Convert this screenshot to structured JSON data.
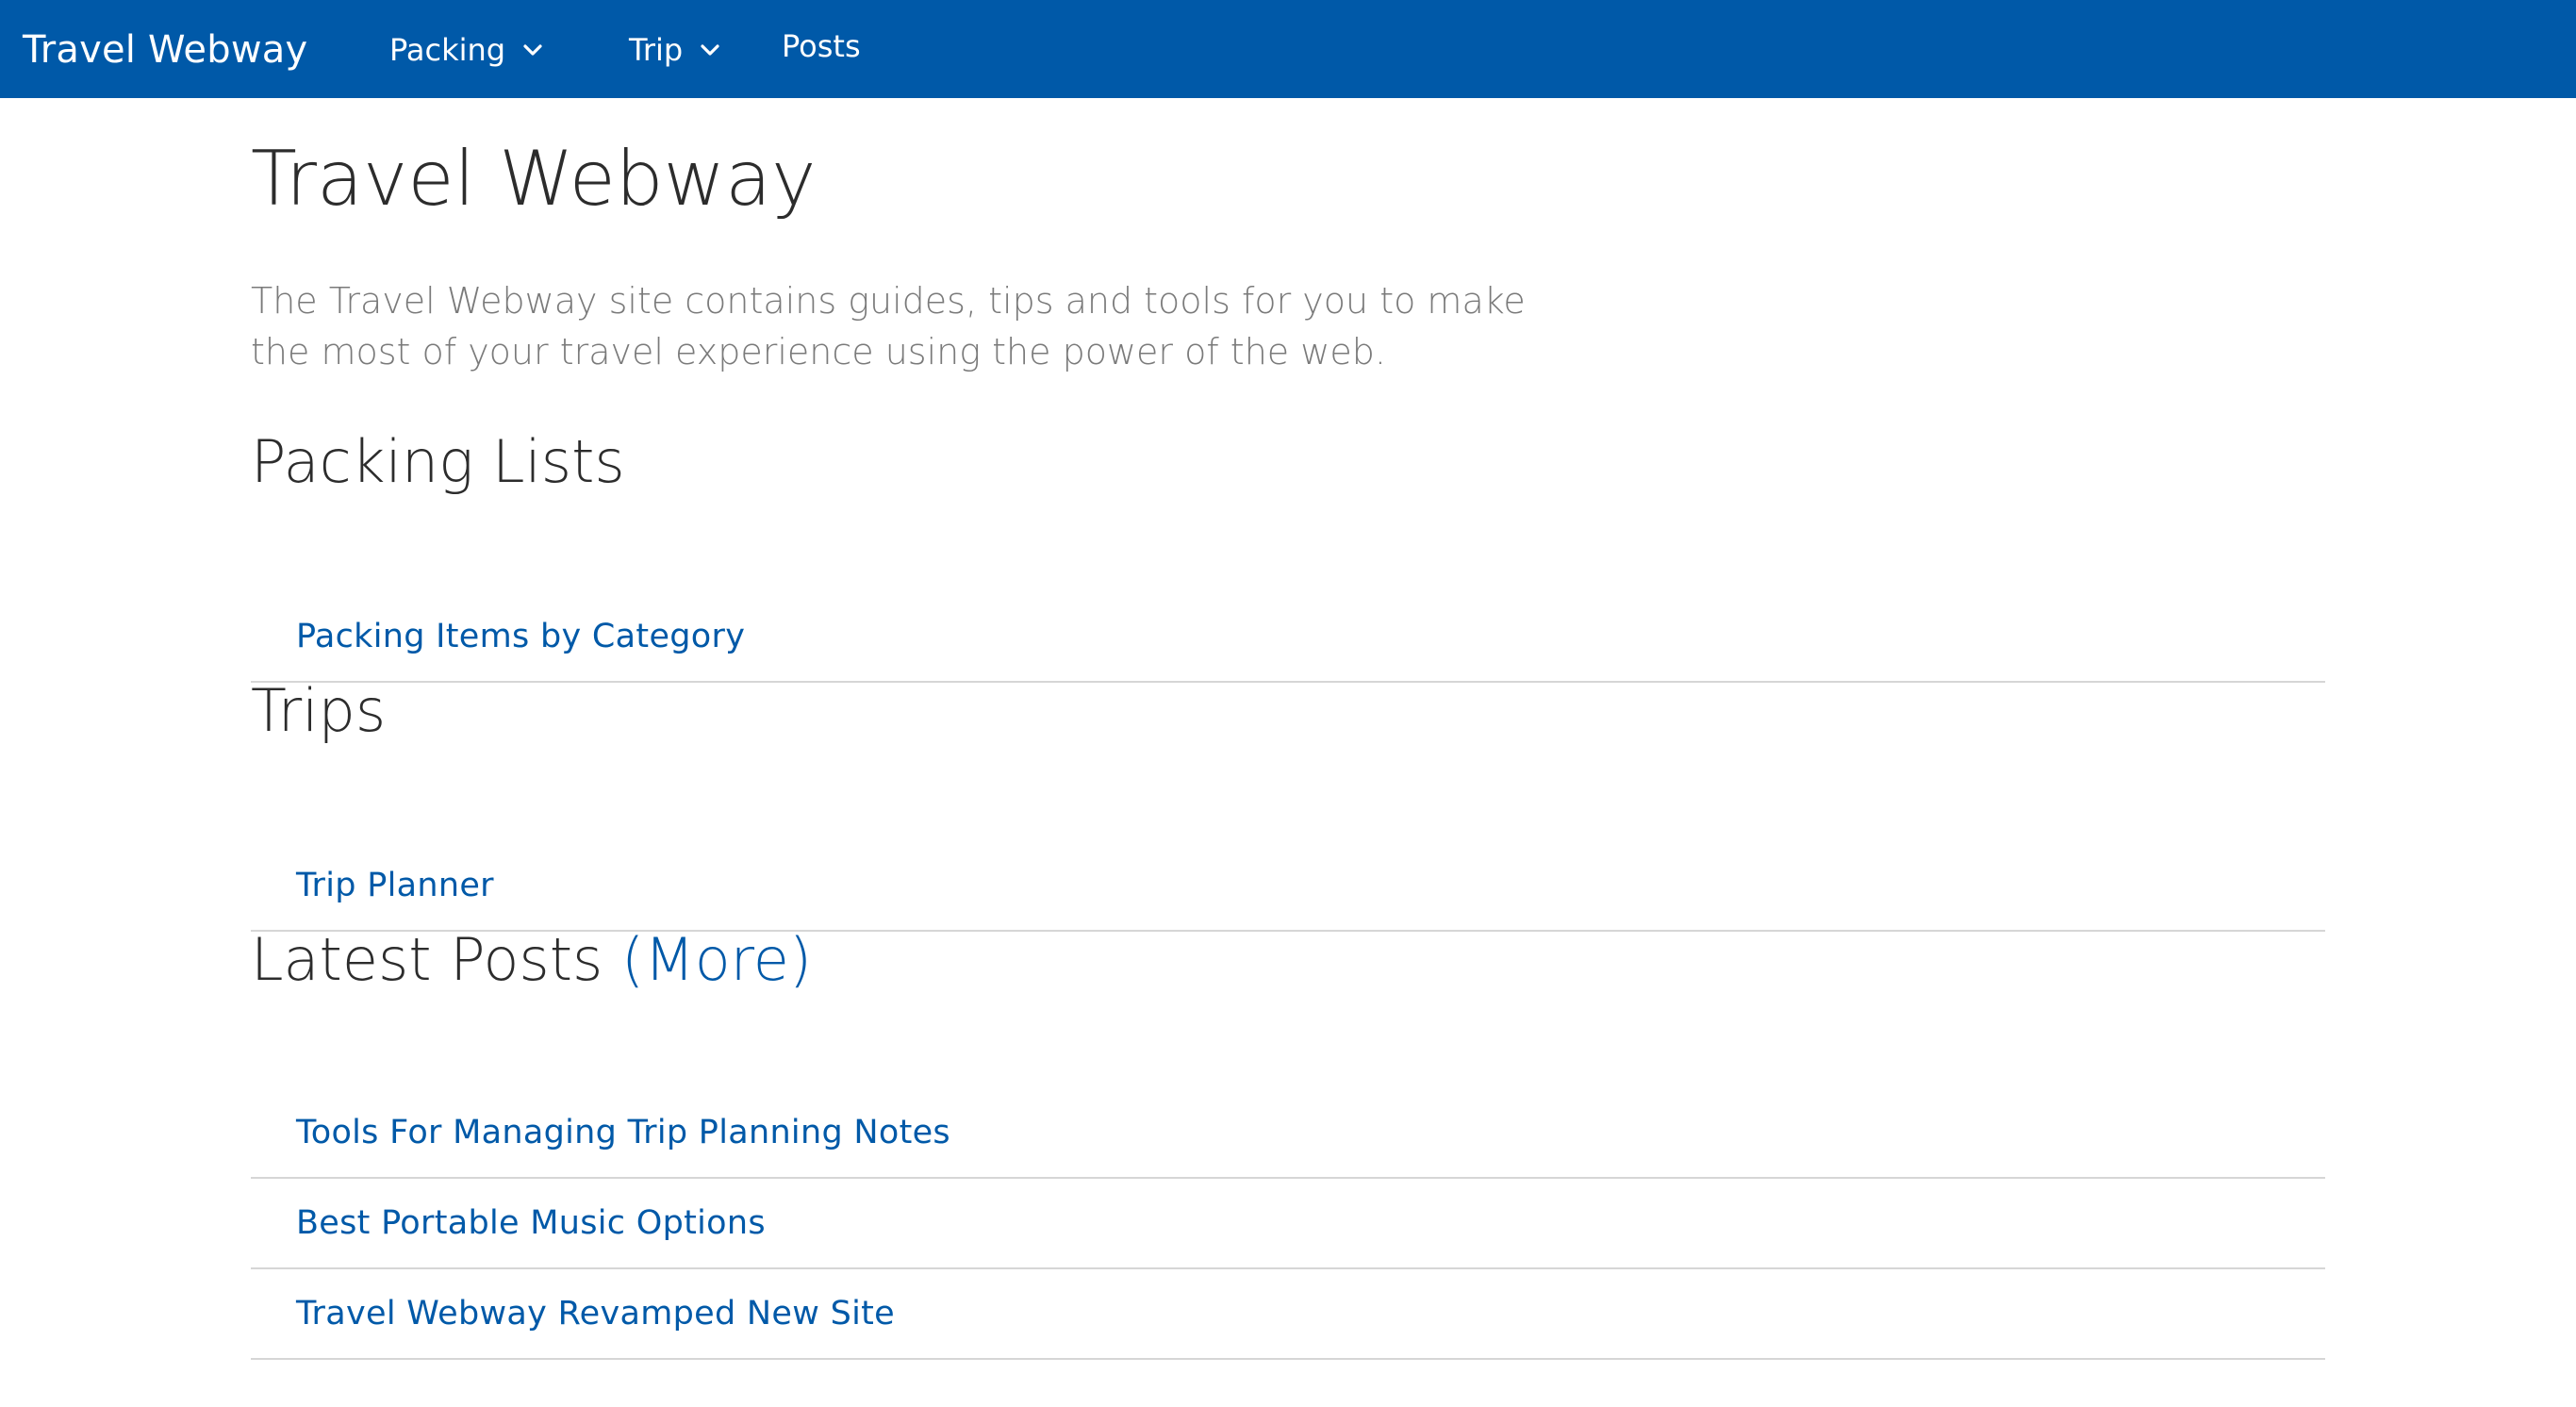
{
  "navbar": {
    "brand": "Travel Webway",
    "items": [
      {
        "label": "Packing",
        "has_dropdown": true
      },
      {
        "label": "Trip",
        "has_dropdown": true
      },
      {
        "label": "Posts",
        "has_dropdown": false
      }
    ]
  },
  "main": {
    "title": "Travel Webway",
    "lead_line1": "The Travel Webway site contains guides, tips and tools for you to make",
    "lead_line2": "the most of your travel experience using the power of the web.",
    "sections": [
      {
        "title": "Packing Lists",
        "links": [
          "Packing Items by Category"
        ]
      },
      {
        "title": "Trips",
        "links": [
          "Trip Planner"
        ]
      },
      {
        "title": "Latest Posts",
        "more_label": "(More)",
        "links": [
          "Tools For Managing Trip Planning Notes",
          "Best Portable Music Options",
          "Travel Webway Revamped New Site"
        ]
      }
    ]
  },
  "colors": {
    "navbar_bg": "#0059a8",
    "link": "#0059a8",
    "heading": "#2c2c2c",
    "lead": "#7a7a7a",
    "divider": "#d6d6d6"
  },
  "icons": {
    "dropdown": "chevron-down-icon"
  }
}
